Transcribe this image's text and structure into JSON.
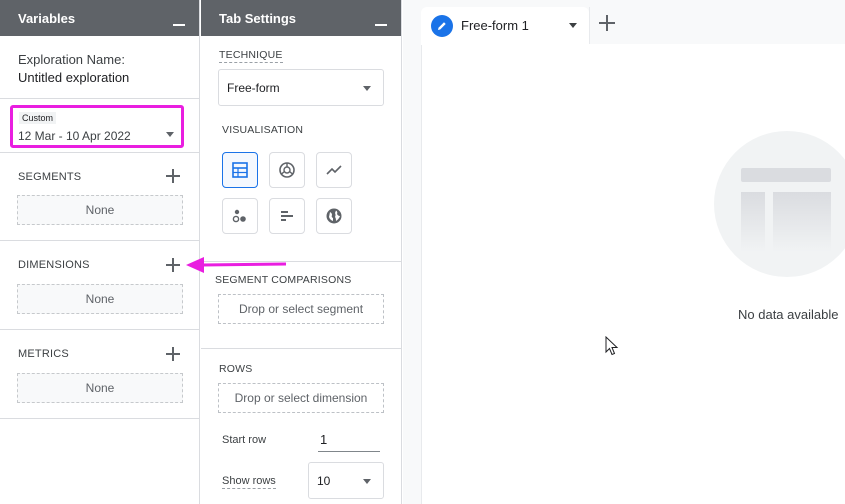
{
  "variables": {
    "header": "Variables",
    "exploration_name_label": "Exploration Name:",
    "exploration_name_value": "Untitled exploration",
    "date_tag": "Custom",
    "date_range": "12 Mar - 10 Apr 2022",
    "segments_label": "SEGMENTS",
    "segments_value": "None",
    "dimensions_label": "DIMENSIONS",
    "dimensions_value": "None",
    "metrics_label": "METRICS",
    "metrics_value": "None"
  },
  "tab_settings": {
    "header": "Tab Settings",
    "technique_label": "TECHNIQUE",
    "technique_value": "Free-form",
    "visualisation_label": "VISUALISATION",
    "visualisation_options": [
      "table-icon",
      "donut-chart-icon",
      "line-chart-icon",
      "scatter-chart-icon",
      "bar-chart-icon",
      "geo-map-icon"
    ],
    "segment_comparisons_label": "SEGMENT COMPARISONS",
    "segment_drop_placeholder": "Drop or select segment",
    "rows_label": "ROWS",
    "rows_drop_placeholder": "Drop or select dimension",
    "start_row_label": "Start row",
    "start_row_value": "1",
    "show_rows_label": "Show rows",
    "show_rows_value": "10"
  },
  "canvas": {
    "tab_title": "Free-form 1",
    "no_data": "No data available"
  },
  "colors": {
    "header_bg": "#5f6368",
    "annotation": "#e91ee0",
    "accent": "#1a73e8"
  }
}
